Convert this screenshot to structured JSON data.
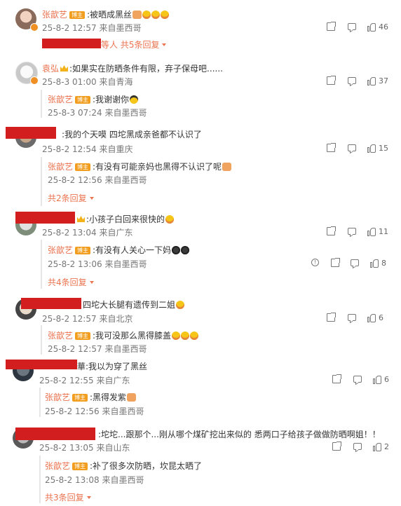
{
  "comments": [
    {
      "name": "张歆艺",
      "badge": "博主",
      "text": ":被晒成黑丝",
      "time": "25-8-2 12:57",
      "loc": "来自墨西哥",
      "likes": "46",
      "more": "等人 共5条回复"
    },
    {
      "name": "袁弘",
      "text": ":如果实在防晒条件有限，弃子保母吧......",
      "time": "25-8-3 01:00",
      "loc": "来自青海",
      "likes": "37",
      "reply": {
        "name": "张歆艺",
        "badge": "博主",
        "text": ":我谢谢你",
        "time": "25-8-3 07:24",
        "loc": "来自墨西哥"
      }
    },
    {
      "text": ":我的个天嗼 四坨黑成亲爸都不认识了",
      "time": "25-8-2 12:54",
      "loc": "来自重庆",
      "likes": "15",
      "reply": {
        "name": "张歆艺",
        "badge": "博主",
        "text": ":有没有可能亲妈也黑得不认识了呢",
        "time": "25-8-2 12:56",
        "loc": "来自墨西哥"
      },
      "more": "共2条回复"
    },
    {
      "text": ":小孩子白回来很快的",
      "time": "25-8-2 13:04",
      "loc": "来自广东",
      "likes": "11",
      "reply": {
        "name": "张歆艺",
        "badge": "博主",
        "text": ":有没有人关心一下妈",
        "time": "25-8-2 13:06",
        "loc": "来自墨西哥",
        "likes": "8"
      },
      "more": "共4条回复"
    },
    {
      "text": "四坨大长腿有遗传到二姐",
      "time": "25-8-2 12:57",
      "loc": "来自北京",
      "likes": "6",
      "reply": {
        "name": "张歆艺",
        "badge": "博主",
        "text": ":我可没那么黑得膝盖",
        "time": "25-8-2 12:57",
        "loc": "来自墨西哥"
      }
    },
    {
      "text": "華:我以为穿了黑丝",
      "time": "25-8-2 12:55",
      "loc": "来自广东",
      "likes": "6",
      "reply": {
        "name": "张歆艺",
        "badge": "博主",
        "text": ":黑得发紫",
        "time": "25-8-2 12:56",
        "loc": "来自墨西哥"
      }
    },
    {
      "text": ":坨坨...跟那个...刚从哪个煤矿挖出来似的 悉两口子给孩子做做防晒啊姐！！",
      "time": "25-8-2 13:05",
      "loc": "来自山东",
      "likes": "2",
      "reply": {
        "name": "张歆艺",
        "badge": "博主",
        "text": ":补了很多次防晒，坎昆太晒了",
        "time": "25-8-2 13:08",
        "loc": "来自墨西哥"
      },
      "more": "共3条回复"
    }
  ]
}
